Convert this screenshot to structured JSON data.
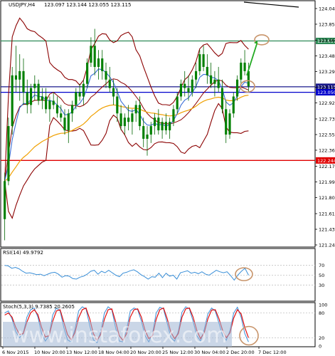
{
  "chart_data": {
    "type": "candlestick",
    "symbol": "USDJPY,H4",
    "header": {
      "symbol": "USDJPY,H4",
      "ohlc": "123.097 123.144 123.055 123.115"
    },
    "y_axis": {
      "min": 121.245,
      "max": 124.04,
      "ticks": [
        "124.040",
        "123.855",
        "123.665",
        "123.480",
        "123.295",
        "123.110",
        "122.925",
        "122.735",
        "122.550",
        "122.365",
        "122.175",
        "121.990",
        "121.805",
        "121.615",
        "121.430",
        "121.245"
      ]
    },
    "x_labels": [
      "6 Nov 2015",
      "10 Nov 20:00",
      "13 Nov 12:00",
      "18 Nov 04:00",
      "20 Nov 20:00",
      "25 Nov 12:00",
      "30 Nov 04:00",
      "2 Dec 20:00",
      "7 Dec 12:00"
    ],
    "levels": [
      {
        "name": "resistance",
        "value": 123.657,
        "label": "123.657",
        "color": "#2e8b57"
      },
      {
        "name": "current_price",
        "value": 123.115,
        "label": "123.115",
        "color": "#1a1a8c"
      },
      {
        "name": "blue_line",
        "value": 123.05,
        "label": "123.050",
        "color": "#0000cc"
      },
      {
        "name": "support",
        "value": 122.244,
        "label": "122.244",
        "color": "#e00000"
      }
    ],
    "candles": [
      [
        121.55,
        122.1,
        121.3,
        122.0
      ],
      [
        122.0,
        122.75,
        121.95,
        122.65
      ],
      [
        122.65,
        123.35,
        122.55,
        123.25
      ],
      [
        123.25,
        123.6,
        123.05,
        123.2
      ],
      [
        123.2,
        123.5,
        122.95,
        123.3
      ],
      [
        123.3,
        123.45,
        122.9,
        123.05
      ],
      [
        123.05,
        123.2,
        122.8,
        122.9
      ],
      [
        122.9,
        123.15,
        122.8,
        123.1
      ],
      [
        123.1,
        123.25,
        122.95,
        123.15
      ],
      [
        123.15,
        123.2,
        122.9,
        122.95
      ],
      [
        122.95,
        123.1,
        122.85,
        123.0
      ],
      [
        123.0,
        123.1,
        122.8,
        122.85
      ],
      [
        122.85,
        123.0,
        122.7,
        122.95
      ],
      [
        122.95,
        123.05,
        122.85,
        122.9
      ],
      [
        122.9,
        123.0,
        122.75,
        122.8
      ],
      [
        122.8,
        122.9,
        122.7,
        122.75
      ],
      [
        122.75,
        122.85,
        122.55,
        122.6
      ],
      [
        122.6,
        122.85,
        122.45,
        122.8
      ],
      [
        122.8,
        122.95,
        122.7,
        122.9
      ],
      [
        122.9,
        123.1,
        122.85,
        123.05
      ],
      [
        123.05,
        123.15,
        122.95,
        123.0
      ],
      [
        123.0,
        123.2,
        122.9,
        123.15
      ],
      [
        123.15,
        123.45,
        123.1,
        123.4
      ],
      [
        123.4,
        123.7,
        123.35,
        123.6
      ],
      [
        123.6,
        123.8,
        123.25,
        123.35
      ],
      [
        123.35,
        123.55,
        123.2,
        123.45
      ],
      [
        123.45,
        123.55,
        123.2,
        123.3
      ],
      [
        123.3,
        123.4,
        123.1,
        123.2
      ],
      [
        123.2,
        123.35,
        123.05,
        123.1
      ],
      [
        123.1,
        123.2,
        122.9,
        123.0
      ],
      [
        123.0,
        123.1,
        122.7,
        122.8
      ],
      [
        122.8,
        122.9,
        122.6,
        122.65
      ],
      [
        122.65,
        122.8,
        122.55,
        122.75
      ],
      [
        122.75,
        122.9,
        122.6,
        122.7
      ],
      [
        122.7,
        122.85,
        122.55,
        122.8
      ],
      [
        122.8,
        122.95,
        122.7,
        122.9
      ],
      [
        122.9,
        123.0,
        122.6,
        122.65
      ],
      [
        122.65,
        122.75,
        122.4,
        122.5
      ],
      [
        122.5,
        122.65,
        122.3,
        122.55
      ],
      [
        122.55,
        122.7,
        122.45,
        122.65
      ],
      [
        122.65,
        122.8,
        122.55,
        122.75
      ],
      [
        122.75,
        122.85,
        122.55,
        122.6
      ],
      [
        122.6,
        122.75,
        122.5,
        122.7
      ],
      [
        122.7,
        122.8,
        122.55,
        122.6
      ],
      [
        122.6,
        122.75,
        122.5,
        122.7
      ],
      [
        122.7,
        122.9,
        122.65,
        122.85
      ],
      [
        122.85,
        123.05,
        122.8,
        123.0
      ],
      [
        123.0,
        123.2,
        122.95,
        123.15
      ],
      [
        123.15,
        123.3,
        123.0,
        123.1
      ],
      [
        123.1,
        123.25,
        122.95,
        123.05
      ],
      [
        123.05,
        123.25,
        123.0,
        123.2
      ],
      [
        123.2,
        123.4,
        123.1,
        123.3
      ],
      [
        123.3,
        123.55,
        123.25,
        123.5
      ],
      [
        123.5,
        123.6,
        123.3,
        123.35
      ],
      [
        123.35,
        123.5,
        123.15,
        123.25
      ],
      [
        123.25,
        123.4,
        123.1,
        123.15
      ],
      [
        123.15,
        123.3,
        123.0,
        123.2
      ],
      [
        123.2,
        123.35,
        123.05,
        123.1
      ],
      [
        123.1,
        123.2,
        122.8,
        122.85
      ],
      [
        122.85,
        122.95,
        122.45,
        122.55
      ],
      [
        122.55,
        122.85,
        122.5,
        122.8
      ],
      [
        122.8,
        123.05,
        122.75,
        123.0
      ],
      [
        123.0,
        123.25,
        122.95,
        123.2
      ],
      [
        123.2,
        123.45,
        123.15,
        123.4
      ],
      [
        123.4,
        123.55,
        123.25,
        123.3
      ],
      [
        123.3,
        123.4,
        123.05,
        123.12
      ]
    ],
    "rsi": {
      "label": "RSI(14) 49.9792",
      "ticks": [
        "70",
        "50",
        "30"
      ],
      "levels": [
        70,
        50,
        30
      ],
      "values": [
        70,
        69,
        64,
        66,
        63,
        58,
        54,
        55,
        53,
        51,
        52,
        49,
        52,
        55,
        56,
        52,
        46,
        49,
        48,
        43,
        42,
        46,
        48,
        52,
        58,
        60,
        52,
        58,
        55,
        60,
        55,
        50,
        47,
        54,
        56,
        59,
        61,
        57,
        51,
        47,
        42,
        47,
        46,
        54,
        45,
        54,
        48,
        50,
        42,
        55,
        57,
        59,
        54,
        56,
        53,
        57,
        52,
        50,
        55,
        60,
        57,
        55,
        57,
        49,
        40,
        50,
        58,
        64,
        50
      ]
    },
    "stochastic": {
      "label": "Stoch(5,3,3) 9.7385 20.2605",
      "ticks": [
        "100",
        "80",
        "20",
        "0"
      ],
      "levels": [
        80,
        20
      ],
      "main": [
        80,
        85,
        65,
        35,
        20,
        30,
        70,
        88,
        92,
        70,
        30,
        12,
        25,
        75,
        92,
        85,
        45,
        15,
        10,
        40,
        85,
        95,
        90,
        50,
        15,
        8,
        35,
        80,
        95,
        88,
        45,
        12,
        10,
        40,
        85,
        92,
        88,
        60,
        25,
        10,
        30,
        80,
        94,
        90,
        55,
        20,
        12,
        35,
        82,
        95,
        90,
        60,
        25,
        12,
        40,
        78,
        92,
        85,
        55,
        25,
        14,
        38,
        80,
        94,
        70,
        30,
        10
      ],
      "signal": [
        75,
        80,
        70,
        45,
        28,
        30,
        58,
        80,
        88,
        76,
        45,
        22,
        25,
        60,
        85,
        88,
        58,
        28,
        15,
        32,
        68,
        88,
        92,
        66,
        30,
        14,
        28,
        65,
        88,
        90,
        60,
        25,
        14,
        30,
        70,
        88,
        90,
        70,
        38,
        18,
        25,
        65,
        88,
        92,
        66,
        33,
        18,
        30,
        70,
        90,
        92,
        70,
        38,
        18,
        32,
        66,
        87,
        88,
        66,
        38,
        20,
        32,
        68,
        88,
        78,
        45,
        20
      ]
    },
    "watermark": "www.instaforex.com"
  }
}
